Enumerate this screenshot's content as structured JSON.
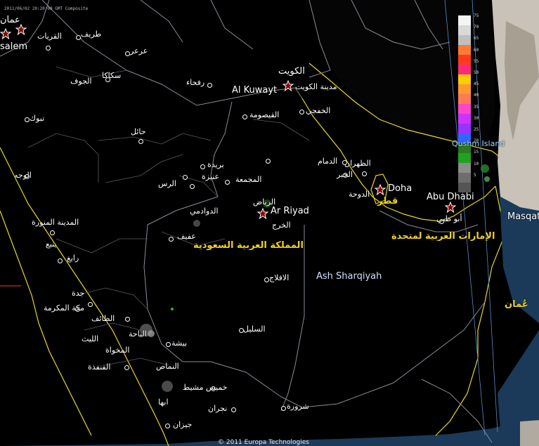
{
  "timestamp": "2011/06/02 20:20:00 GMT Composite",
  "credit": "© 2011 Europa Technologies",
  "colors": {
    "land": "#000000",
    "sea": "#1b3a5a",
    "border": "#8a8a9a",
    "coast": "#e8d820",
    "country_label": "#f2d21a"
  },
  "labels": {
    "amman": "عمان",
    "jerusalem": "salem",
    "qurayyat": "القريات",
    "tabarjal": "طريف",
    "arar": "عرعر",
    "jawf": "الجوف",
    "sakaka": "سكاكا",
    "tabuk": "تبوك",
    "rafha": "رفحاء",
    "kuwait_ar": "الكويت",
    "kuwait_en": "Al Kuwayt",
    "kuwait_city": "مدينة الكويت",
    "khafji": "الخفجي",
    "qaysumah": "القيصومة",
    "hail": "حائل",
    "wajh": "الوجه",
    "buraydah": "بريدة",
    "unayzah": "عنيزة",
    "rass": "الرس",
    "majmaah": "المجمعة",
    "dammam": "الدمام",
    "dhahran": "الظهران",
    "khobar": "الخبر",
    "doha_en": "Doha",
    "doha_ar": "الدوحة",
    "qatar": "قطر",
    "riyadh_ar": "الرياض",
    "riyadh_en": "Ar Riyad",
    "kharj": "الخرج",
    "dawadmi": "الدوادمي",
    "madinah": "المدينة المنورة",
    "yanbu": "ينبع",
    "afif": "عفيف",
    "saudi": "المملكة العربية السعودية",
    "abudhabi_en": "Abu Dhabi",
    "abudhabi_ar": "أبو ظبي",
    "uae": "الإمارات العربية لمتحدة",
    "qushm": "Qushm Island",
    "masqat": "Masqat",
    "oman": "عُمان",
    "rabigh": "رابغ",
    "sharqiyah": "Ash Sharqiyah",
    "aflaj": "الافلاج",
    "jeddah": "جدة",
    "makkah": "مكة المكرمة",
    "taif": "الطائف",
    "baha": "الباحة",
    "lith": "الليث",
    "bishah": "بيشة",
    "qunfudhah": "القنفذة",
    "namas": "النماص",
    "sulayyil": "السليل",
    "khamis": "خميس مشيط",
    "abha": "ابها",
    "najran": "نجران",
    "sharurah": "شرورة",
    "jizan": "جيزان",
    "makhwah": "المخواة"
  },
  "legend": {
    "ticks": [
      "75",
      "70",
      "65",
      "60",
      "55",
      "50",
      "45",
      "40",
      "35",
      "30",
      "25",
      "20",
      "15",
      "10",
      "5"
    ],
    "colors": [
      "#f4f4f4",
      "#d9d9d9",
      "#bfbfbf",
      "#ff7a33",
      "#ff3b1f",
      "#ff2a7a",
      "#ffcc00",
      "#ff9933",
      "#ff7a55",
      "#ff44cc",
      "#cc33ff",
      "#9933ff",
      "#3366ff",
      "#2a7a1f",
      "#1fa31f",
      "#8c8c8c",
      "#6e6e6e",
      "#555555"
    ]
  }
}
